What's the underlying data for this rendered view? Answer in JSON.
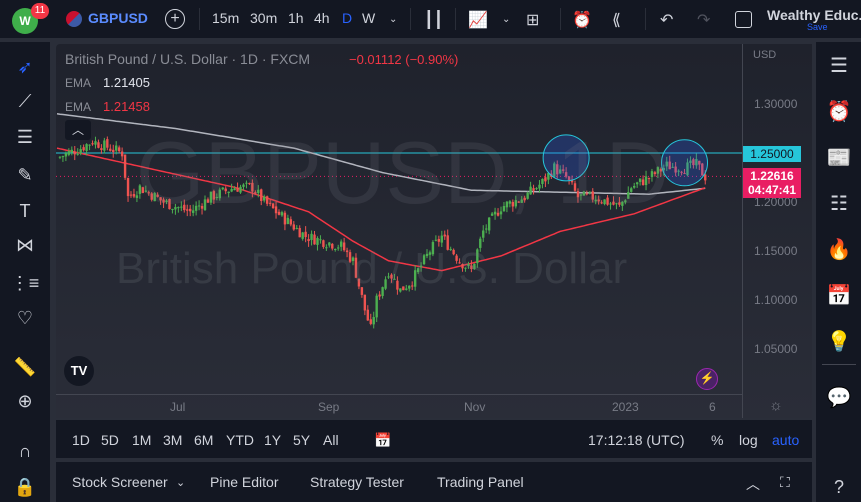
{
  "topbar": {
    "notif_count": "11",
    "symbol": "GBPUSD",
    "intervals": [
      "15m",
      "30m",
      "1h",
      "4h",
      "D",
      "W"
    ],
    "account": "Wealthy Educ...",
    "save": "Save"
  },
  "legend": {
    "title": "British Pound / U.S. Dollar · 1D · FXCM",
    "change": "−0.01112 (−0.90%)",
    "ema1_label": "EMA",
    "ema1_value": "1.21405",
    "ema2_label": "EMA",
    "ema2_value": "1.21458"
  },
  "watermark": {
    "symbol": "GBPUSD, 1D",
    "name": "British Pound / U.S. Dollar"
  },
  "price_axis": {
    "currency": "USD",
    "ticks": [
      "1.30000",
      "1.20000",
      "1.15000",
      "1.10000",
      "1.05000"
    ],
    "level_label": "1.25000",
    "last_price": "1.22616",
    "countdown": "04:47:41"
  },
  "time_axis": {
    "ticks": [
      "Jul",
      "Sep",
      "Nov",
      "2023",
      "6"
    ]
  },
  "bottombar": {
    "ranges": [
      "1D",
      "5D",
      "1M",
      "3M",
      "6M",
      "YTD",
      "1Y",
      "5Y",
      "All"
    ],
    "clock": "17:12:18 (UTC)",
    "percent": "%",
    "log": "log",
    "auto": "auto"
  },
  "panel": {
    "tabs": [
      "Stock Screener",
      "Pine Editor",
      "Strategy Tester",
      "Trading Panel"
    ]
  },
  "colors": {
    "up": "#26a69a",
    "up_candle": "#4caf50",
    "down": "#ef5350",
    "accent": "#2962ff",
    "level": "#26c6da",
    "price_tag": "#e91e63"
  },
  "chart_data": {
    "type": "candlestick",
    "symbol": "GBPUSD",
    "timeframe": "1D",
    "ylim": [
      1.0,
      1.34
    ],
    "horizontal_level": 1.25,
    "last_price": 1.22616,
    "price_path": [
      [
        0,
        1.245
      ],
      [
        8,
        1.255
      ],
      [
        12,
        1.262
      ],
      [
        18,
        1.255
      ],
      [
        22,
        1.25
      ],
      [
        24,
        1.205
      ],
      [
        28,
        1.215
      ],
      [
        36,
        1.2
      ],
      [
        45,
        1.19
      ],
      [
        52,
        1.205
      ],
      [
        60,
        1.215
      ],
      [
        66,
        1.215
      ],
      [
        70,
        1.2
      ],
      [
        76,
        1.185
      ],
      [
        84,
        1.165
      ],
      [
        90,
        1.16
      ],
      [
        96,
        1.155
      ],
      [
        100,
        1.14
      ],
      [
        104,
        1.09
      ],
      [
        106,
        1.07
      ],
      [
        108,
        1.1
      ],
      [
        112,
        1.13
      ],
      [
        116,
        1.11
      ],
      [
        120,
        1.12
      ],
      [
        126,
        1.15
      ],
      [
        130,
        1.165
      ],
      [
        136,
        1.14
      ],
      [
        140,
        1.13
      ],
      [
        144,
        1.17
      ],
      [
        150,
        1.195
      ],
      [
        158,
        1.205
      ],
      [
        164,
        1.22
      ],
      [
        168,
        1.235
      ],
      [
        172,
        1.225
      ],
      [
        176,
        1.205
      ],
      [
        182,
        1.205
      ],
      [
        186,
        1.2
      ],
      [
        190,
        1.195
      ],
      [
        194,
        1.215
      ],
      [
        200,
        1.225
      ],
      [
        206,
        1.237
      ],
      [
        212,
        1.235
      ],
      [
        216,
        1.238
      ],
      [
        219,
        1.226
      ]
    ],
    "ema_white": [
      [
        0,
        1.29
      ],
      [
        40,
        1.275
      ],
      [
        80,
        1.255
      ],
      [
        110,
        1.23
      ],
      [
        140,
        1.212
      ],
      [
        170,
        1.21
      ],
      [
        200,
        1.208
      ],
      [
        219,
        1.214
      ]
    ],
    "ema_red": [
      [
        0,
        1.255
      ],
      [
        30,
        1.235
      ],
      [
        60,
        1.215
      ],
      [
        85,
        1.19
      ],
      [
        100,
        1.16
      ],
      [
        112,
        1.14
      ],
      [
        130,
        1.13
      ],
      [
        150,
        1.145
      ],
      [
        170,
        1.17
      ],
      [
        195,
        1.188
      ],
      [
        219,
        1.2146
      ]
    ],
    "circles": [
      [
        172,
        1.245
      ],
      [
        212,
        1.24
      ]
    ]
  }
}
